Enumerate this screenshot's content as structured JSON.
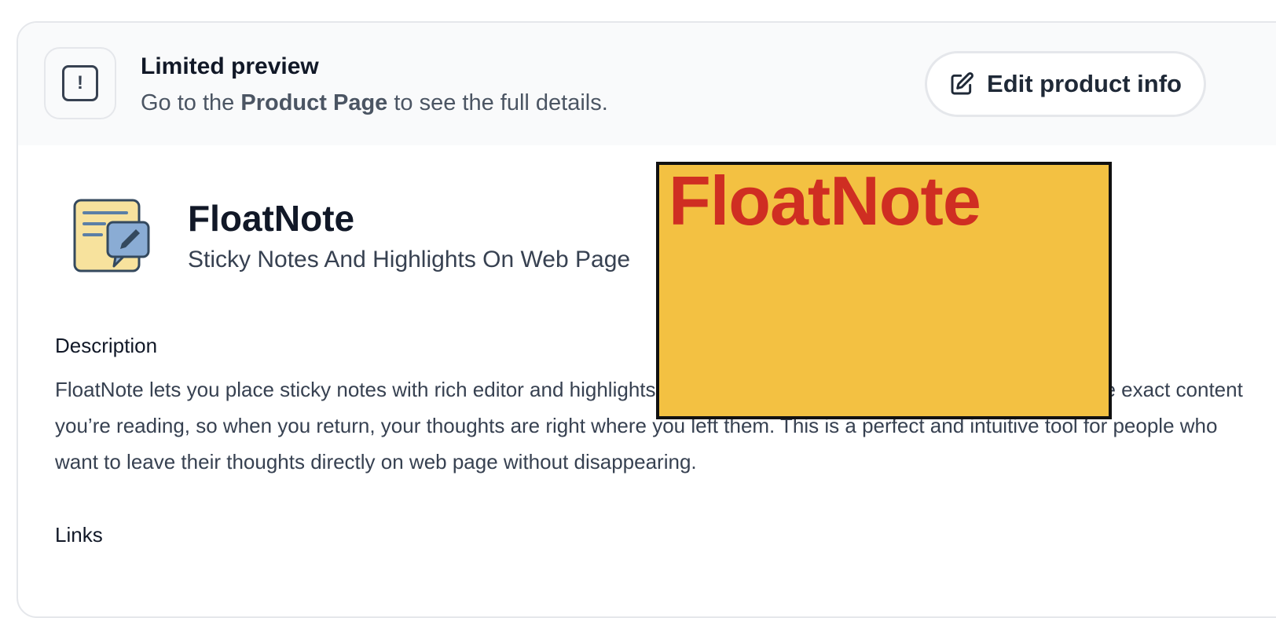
{
  "banner": {
    "title": "Limited preview",
    "text_before": "Go to the ",
    "text_link": "Product Page",
    "text_after": " to see the full details.",
    "alert_icon": "exclamation-icon",
    "alert_symbol": "!"
  },
  "edit_button": {
    "label": "Edit product info",
    "icon": "edit-icon"
  },
  "product": {
    "name": "FloatNote",
    "tagline": "Sticky Notes And Highlights On Web Page",
    "icon": "note-edit-icon"
  },
  "description": {
    "title": "Description",
    "text": "FloatNote lets you place sticky notes with rich editor and highlights on any web page. Your notes stay anchored to the exact content you’re reading, so when you return, your thoughts are right where you left them. This is a perfect and intuitive tool for people who want to leave their thoughts directly on web page without disappearing."
  },
  "links": {
    "title": "Links"
  },
  "overlay": {
    "text": "FloatNote",
    "background": "#f3c142",
    "text_color": "#cf2e22"
  },
  "colors": {
    "banner_bg": "#f9fafb",
    "border": "#e5e7eb",
    "text_primary": "#111827",
    "text_secondary": "#4b5563"
  }
}
